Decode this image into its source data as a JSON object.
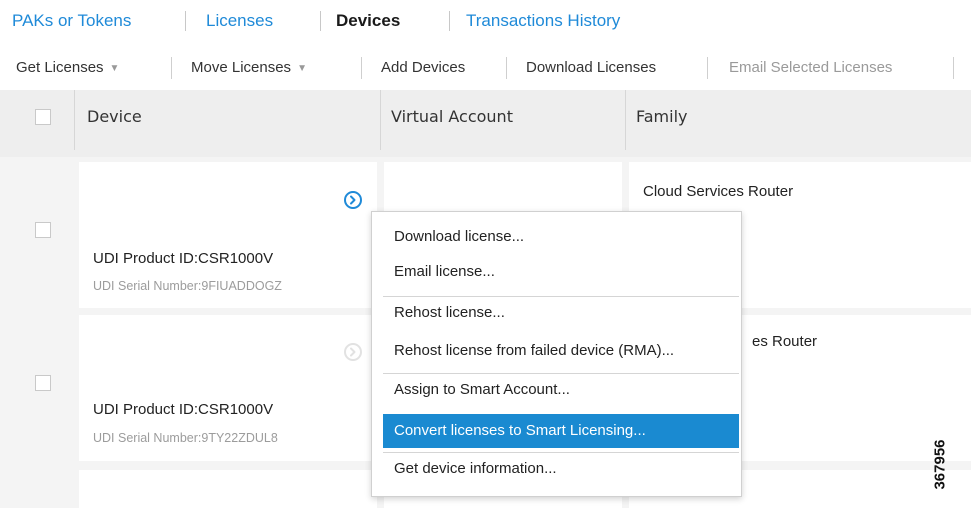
{
  "tabs": [
    {
      "label": "PAKs or Tokens"
    },
    {
      "label": "Licenses"
    },
    {
      "label": "Devices"
    },
    {
      "label": "Transactions History"
    }
  ],
  "toolbar": {
    "get_licenses": "Get Licenses",
    "move_licenses": "Move Licenses",
    "add_devices": "Add Devices",
    "download_licenses": "Download Licenses",
    "email_selected": "Email Selected Licenses"
  },
  "table": {
    "headers": {
      "device": "Device",
      "virtual_account": "Virtual Account",
      "family": "Family"
    }
  },
  "rows": [
    {
      "udi_product": "UDI Product ID:CSR1000V",
      "udi_serial": "UDI Serial Number:9FIUADDOGZ",
      "family": "Cloud Services Router"
    },
    {
      "udi_product": "UDI Product ID:CSR1000V",
      "udi_serial": "UDI Serial Number:9TY22ZDUL8",
      "family": "Cloud Services Router"
    }
  ],
  "row2_family_visible": "es Router",
  "context_menu": [
    {
      "label": "Download license..."
    },
    {
      "label": "Email license..."
    },
    {
      "label": "Rehost license..."
    },
    {
      "label": "Rehost license from failed device (RMA)..."
    },
    {
      "label": "Assign to Smart Account..."
    },
    {
      "label": "Convert licenses to Smart Licensing..."
    },
    {
      "label": "Get device information..."
    }
  ],
  "figure_number": "367956",
  "colors": {
    "link": "#1f8ad8",
    "highlight": "#1a8ad1",
    "header_bg": "#eeeeee",
    "row_bg": "#f4f4f4"
  },
  "icons": {
    "caret": "caret-down-icon",
    "row_action": "chevron-circle-right-icon"
  }
}
